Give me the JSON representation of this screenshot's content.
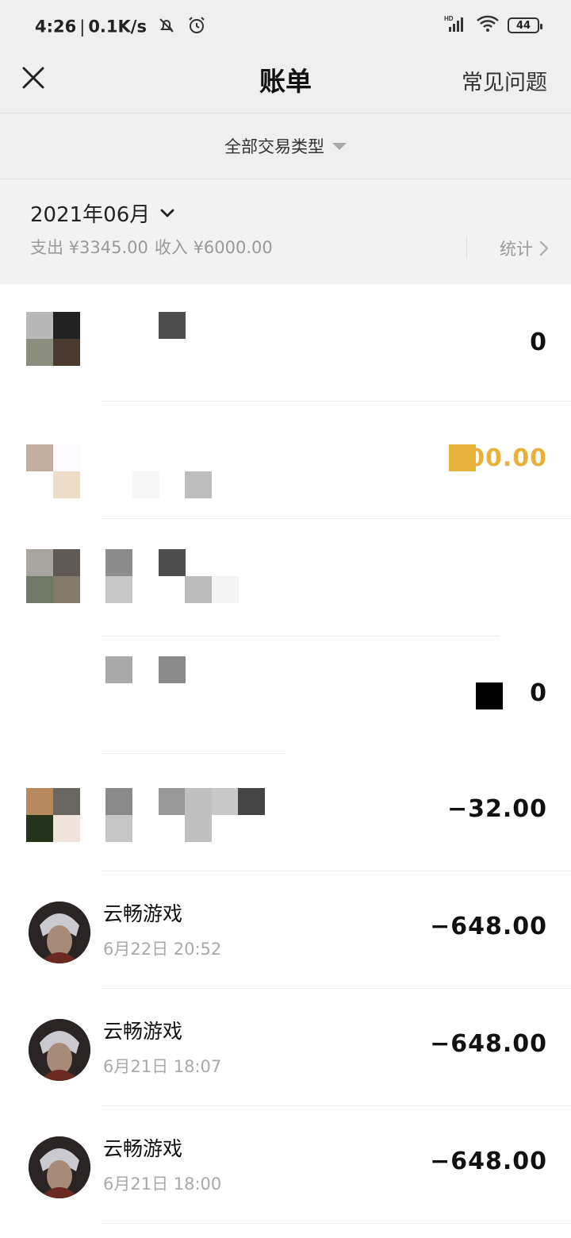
{
  "status_bar": {
    "time": "4:26",
    "speed": "0.1K/s",
    "battery": "44",
    "network": "HD"
  },
  "header": {
    "title": "账单",
    "faq_label": "常见问题",
    "close_icon": "close-icon"
  },
  "filter": {
    "label": "全部交易类型"
  },
  "month_section": {
    "month": "2021年06月",
    "expense": "支出 ¥3345.00",
    "income": "收入 ¥6000.00",
    "stats_label": "统计"
  },
  "transactions": [
    {
      "name": "",
      "time": "",
      "amount": "0"
    },
    {
      "name": "",
      "time": "",
      "amount": "000.00"
    },
    {
      "name": "",
      "time": "",
      "amount": ""
    },
    {
      "name": "",
      "time": "",
      "amount": "0"
    },
    {
      "name": "",
      "time": "",
      "amount": "−32.00"
    },
    {
      "name": "云畅游戏",
      "time": "6月22日 20:52",
      "amount": "−648.00"
    },
    {
      "name": "云畅游戏",
      "time": "6月21日 18:07",
      "amount": "−648.00"
    },
    {
      "name": "云畅游戏",
      "time": "6月21日 18:00",
      "amount": "−648.00"
    }
  ],
  "colors": {
    "income_accent": "#e8b23a",
    "header_bg": "#efefef"
  }
}
